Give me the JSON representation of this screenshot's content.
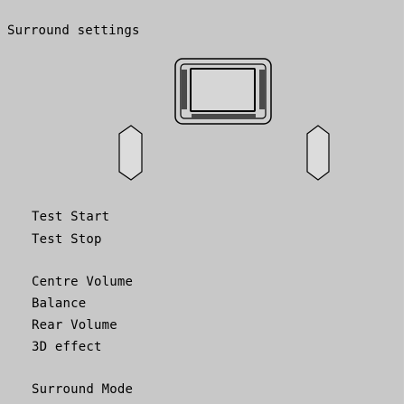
{
  "screen": {
    "title": "Surround settings"
  },
  "diagram": {
    "tv_icon": "tv-icon",
    "left_speaker_icon": "speaker-icon",
    "right_speaker_icon": "speaker-icon"
  },
  "menu": {
    "test_start": "Test Start",
    "test_stop": "Test Stop",
    "centre_volume": "Centre Volume",
    "balance": "Balance",
    "rear_volume": "Rear Volume",
    "effect_3d": "3D effect",
    "surround_mode": "Surround Mode"
  },
  "colors": {
    "panel_bg": "#c8c8c8",
    "tv_screen": "#d6d6d6",
    "tv_bars": "#4a4a4a",
    "speaker_fill": "#dcdcdc",
    "text": "#000000"
  }
}
